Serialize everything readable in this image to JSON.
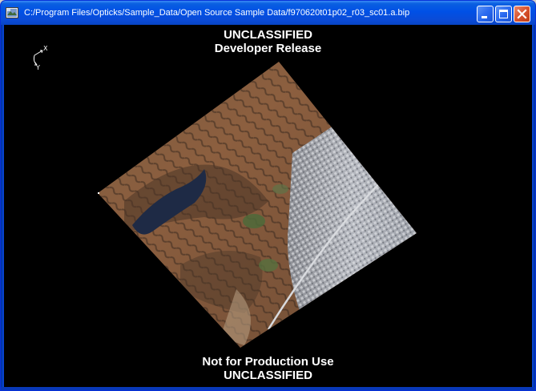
{
  "window": {
    "title": "C:/Program Files/Opticks/Sample_Data/Open Source Sample Data/f970620t01p02_r03_sc01.a.bip",
    "app_icon": "opticks-app-icon",
    "controls": {
      "minimize": "minimize-icon",
      "maximize": "maximize-icon",
      "close": "close-icon"
    }
  },
  "view": {
    "classification_top": "UNCLASSIFIED",
    "release_label": "Developer Release",
    "production_label": "Not for Production Use",
    "classification_bottom": "UNCLASSIFIED",
    "axis": {
      "x_label": "X",
      "y_label": "Y"
    },
    "background_color": "#000000"
  },
  "colors": {
    "titlebar": "#0050e6",
    "close_button": "#d8522d",
    "banner_text": "#ffffff"
  }
}
